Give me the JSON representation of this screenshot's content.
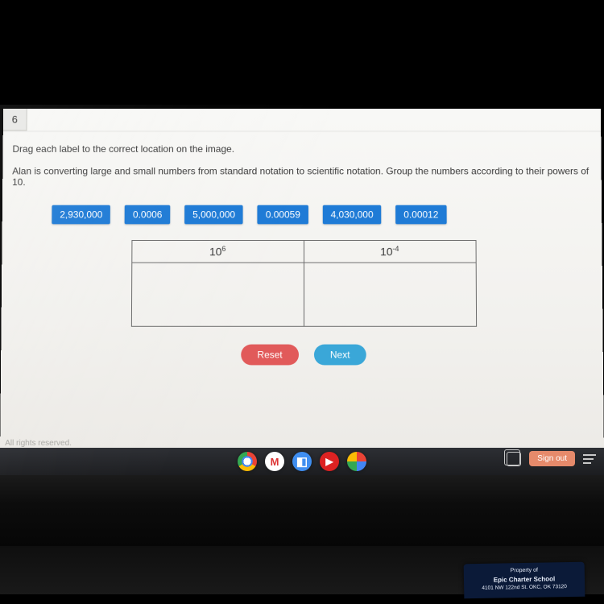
{
  "tab_label": "6",
  "instruction_1": "Drag each label to the correct location on the image.",
  "instruction_2": "Alan is converting large and small numbers from standard notation to scientific notation. Group the numbers according to their powers of 10.",
  "drag_labels": [
    "2,930,000",
    "0.0006",
    "5,000,000",
    "0.00059",
    "4,030,000",
    "0.00012"
  ],
  "table_headers": {
    "col1_base": "10",
    "col1_exp": "6",
    "col2_base": "10",
    "col2_exp": "-4"
  },
  "buttons": {
    "reset": "Reset",
    "next": "Next"
  },
  "footer": "All rights reserved.",
  "taskbar": {
    "signout": "Sign out"
  },
  "sticker": {
    "line1": "Property of",
    "line2": "Epic Charter School",
    "line3": "4101 NW 122nd St. OKC, OK 73120"
  }
}
